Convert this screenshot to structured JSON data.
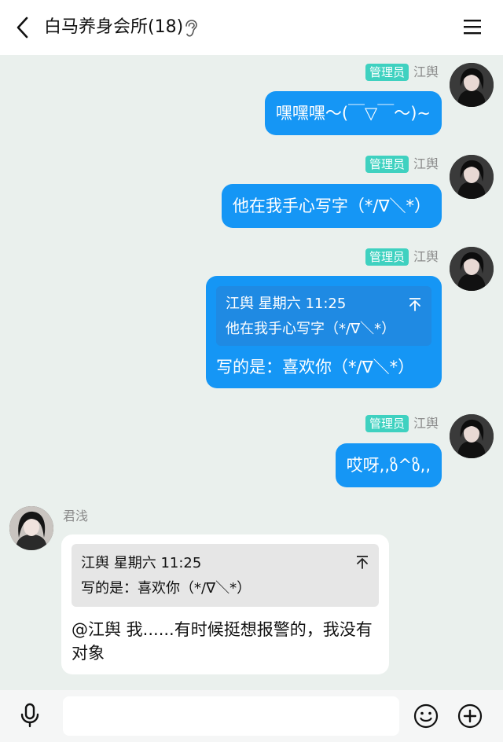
{
  "header": {
    "title": "白马养身会所(18)"
  },
  "messages": [
    {
      "badge": "管理员",
      "sender": "江舆",
      "text": "嘿嘿嘿～(￣▽￣～)~"
    },
    {
      "badge": "管理员",
      "sender": "江舆",
      "text": "他在我手心写字（*/∇＼*）"
    },
    {
      "badge": "管理员",
      "sender": "江舆",
      "quote": {
        "header": "江舆 星期六 11:25",
        "text": "他在我手心写字（*/∇＼*）"
      },
      "text": "写的是：喜欢你（*/∇＼*）"
    },
    {
      "badge": "管理员",
      "sender": "江舆",
      "text": "哎呀,,ზ^ზ,,"
    },
    {
      "sender": "君浅",
      "quote": {
        "header": "江舆 星期六 11:25",
        "text": "写的是：喜欢你（*/∇＼*）"
      },
      "text": "@江舆 我......有时候挺想报警的，我没有对象"
    }
  ],
  "input": {
    "placeholder": ""
  }
}
